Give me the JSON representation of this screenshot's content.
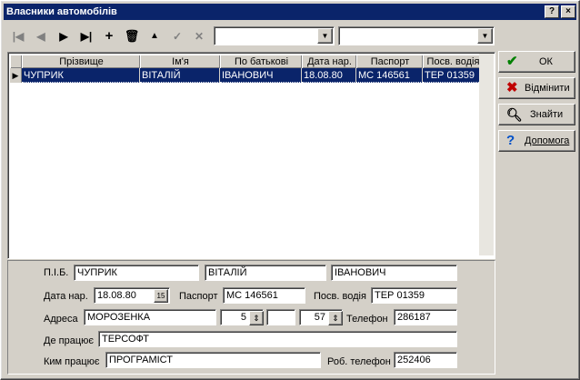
{
  "window": {
    "title": "Власники автомобілів",
    "help_label": "?",
    "close_label": "×"
  },
  "toolbar": {
    "first": "|◀",
    "prior": "◀",
    "next": "▶",
    "last": "▶|",
    "insert": "+",
    "delete": "🗑",
    "edit": "▲",
    "post": "✓",
    "cancel": "✕",
    "combo1_value": "",
    "combo2_value": ""
  },
  "grid": {
    "columns": [
      "Прізвище",
      "Ім'я",
      "По батькові",
      "Дата нар.",
      "Паспорт",
      "Посв. водія"
    ],
    "rows": [
      [
        "ЧУПРИК",
        "ВІТАЛІЙ",
        "ІВАНОВИЧ",
        "18.08.80",
        "МС 146561",
        "ТЕР 01359"
      ]
    ]
  },
  "actions": {
    "ok": "ОК",
    "cancel": "Відмінити",
    "find": "Знайти",
    "help": "Допомога"
  },
  "form": {
    "pib_label": "П.І.Б.",
    "surname": "ЧУПРИК",
    "name": "ВІТАЛІЙ",
    "patronymic": "ІВАНОВИЧ",
    "birth_label": "Дата нар.",
    "birth": "18.08.80",
    "calendar_label": "15",
    "passport_label": "Паспорт",
    "passport": "МС 146561",
    "license_label": "Посв. водія",
    "license": "ТЕР 01359",
    "address_label": "Адреса",
    "street": "МОРОЗЕНКА",
    "house": "5",
    "building": "",
    "flat": "57",
    "phone_label": "Телефон",
    "phone": "286187",
    "work_label": "Де працює",
    "work": "ТЕРСОФТ",
    "job_label": "Ким працює",
    "job": "ПРОГРАМІСТ",
    "work_phone_label": "Роб. телефон",
    "work_phone": "252406"
  },
  "colors": {
    "title_bg": "#0a246a",
    "selection": "#0a246a",
    "face": "#d4d0c8"
  }
}
